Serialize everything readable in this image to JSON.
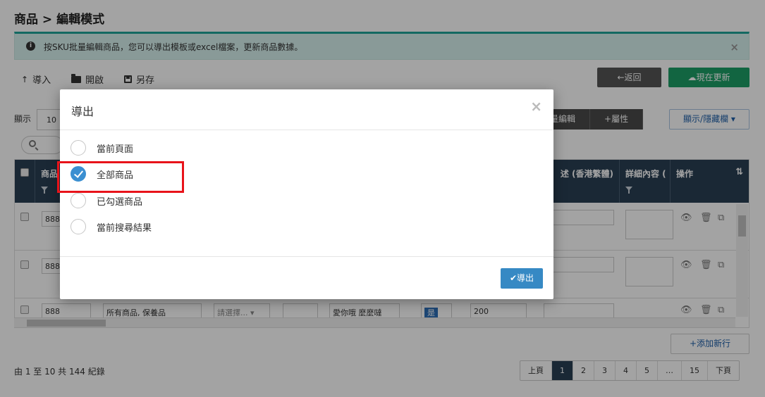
{
  "page": {
    "title": "商品 > 編輯模式",
    "info_text": "按SKU批量編輯商品，您可以導出模板或excel檔案，更新商品數據。",
    "info_icon": "info-circle-icon",
    "close_glyph": "×"
  },
  "toolbar": {
    "import_label": "導入",
    "open_label": "開啟",
    "save_as_label": "另存",
    "back_label": "返回",
    "update_now_label": "現在更新"
  },
  "list_controls": {
    "show_label": "顯示",
    "page_size": "10",
    "bulk_edit_label": "量編輯",
    "attributes_label": "屬性",
    "show_hide_columns_label": "顯示/隱藏欄"
  },
  "table": {
    "headers": {
      "product": "商品",
      "description_hk": "述 (香港繁體)",
      "details": "詳細內容 (",
      "actions": "操作"
    },
    "rows": [
      {
        "sku": "888"
      },
      {
        "sku": "888"
      },
      {
        "sku": "888",
        "category": "所有商品, 保養品",
        "select_placeholder": "請選擇...",
        "name": "愛你哦 麼麼噠",
        "flag": "是",
        "value": "200"
      }
    ]
  },
  "footer": {
    "add_row_label": "添加新行",
    "summary": "由 1 至 10 共 144 紀錄",
    "pagination": [
      "上頁",
      "1",
      "2",
      "3",
      "4",
      "5",
      "…",
      "15",
      "下頁"
    ],
    "active_page": "1"
  },
  "modal": {
    "title": "導出",
    "options": [
      {
        "label": "當前頁面",
        "checked": false
      },
      {
        "label": "全部商品",
        "checked": true
      },
      {
        "label": "已勾選商品",
        "checked": false
      },
      {
        "label": "當前搜尋結果",
        "checked": false
      }
    ],
    "export_label": "導出"
  },
  "colors": {
    "header_dark": "#2a3f54",
    "update_green": "#1d9f67",
    "export_blue": "#3689c4",
    "highlight_red": "#e8131a"
  }
}
